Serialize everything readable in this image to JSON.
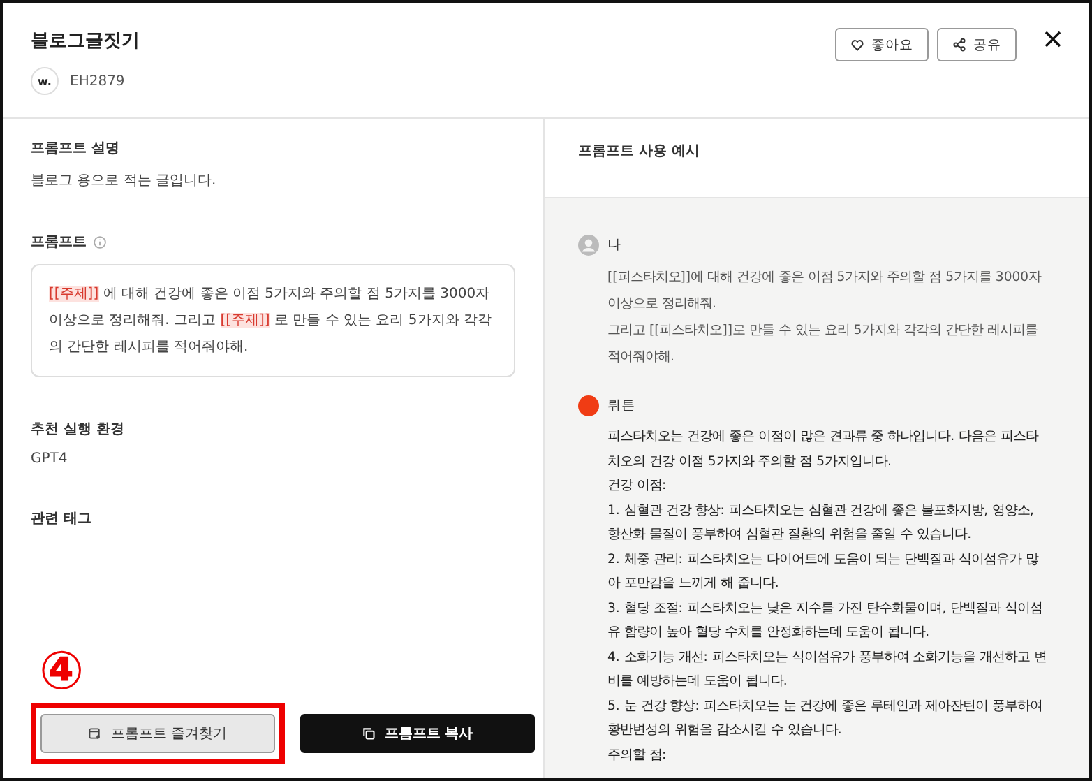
{
  "header": {
    "title": "블로그글짓기",
    "author": {
      "avatar": "w.",
      "name": "EH2879"
    },
    "buttons": [
      {
        "kind": "like",
        "label": "좋아요"
      },
      {
        "kind": "share",
        "label": "공유"
      }
    ]
  },
  "left": {
    "sections": [
      {
        "kind": "text",
        "label": "프롬프트 설명",
        "value": "블로그 용으로 적는 글입니다."
      },
      {
        "kind": "prompt",
        "label": "프롬프트",
        "segments": [
          {
            "kind": "variable",
            "text": "[[주제]]"
          },
          {
            "kind": "text",
            "text": " 에 대해 건강에 좋은 이점 5가지와 주의할 점 5가지를 3000자 이상으로 정리해줘. 그리고 "
          },
          {
            "kind": "variable",
            "text": "[[주제]]"
          },
          {
            "kind": "text",
            "text": " 로 만들 수 있는 요리 5가지와 각각의 간단한 레시피를 적어줘야해."
          }
        ]
      },
      {
        "kind": "text",
        "label": "추천 실행 환경",
        "value": "GPT4"
      },
      {
        "kind": "text",
        "label": "관련 태그"
      }
    ],
    "annotation": "④",
    "actions": [
      {
        "kind": "favorite",
        "label": "프롬프트 즐겨찾기",
        "highlighted": true
      },
      {
        "kind": "copy",
        "label": "프롬프트 복사",
        "highlighted": false
      }
    ]
  },
  "right": {
    "title": "프롬프트 사용 예시",
    "messages": [
      {
        "kind": "user",
        "author": "나",
        "lines": [
          "[[피스타치오]]에 대해  건강에 좋은 이점 5가지와 주의할 점 5가지를 3000자 이상으로 정리해줘.",
          "그리고 [[피스타치오]]로 만들 수 있는 요리 5가지와 각각의 간단한 레시피를 적어줘야해."
        ]
      },
      {
        "kind": "bot",
        "author": "뤼튼",
        "lines": [
          "피스타치오는 건강에 좋은 이점이 많은 견과류 중 하나입니다. 다음은 피스타치오의 건강 이점 5가지와 주의할 점 5가지입니다.",
          "건강 이점:",
          "1. 심혈관 건강 향상: 피스타치오는 심혈관 건강에 좋은 불포화지방, 영양소, 항산화 물질이 풍부하여 심혈관 질환의 위험을 줄일 수 있습니다.",
          "2. 체중 관리: 피스타치오는 다이어트에 도움이 되는 단백질과 식이섬유가 많아 포만감을 느끼게 해 줍니다.",
          "3. 혈당 조절: 피스타치오는 낮은 지수를 가진 탄수화물이며, 단백질과 식이섬유 함량이 높아 혈당 수치를 안정화하는데 도움이 됩니다.",
          "4. 소화기능 개선: 피스타치오는 식이섬유가 풍부하여 소화기능을 개선하고 변비를 예방하는데 도움이 됩니다.",
          "5. 눈 건강 향상: 피스타치오는 눈 건강에 좋은 루테인과 제아잔틴이 풍부하여 황반변성의 위험을 감소시킬 수 있습니다.",
          "주의할 점:"
        ]
      }
    ]
  }
}
